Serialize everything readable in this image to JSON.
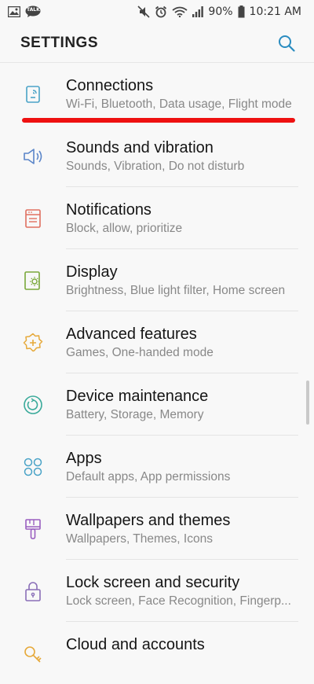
{
  "status_bar": {
    "battery_percent": "90%",
    "time": "10:21 AM",
    "talk_badge": "TALK"
  },
  "header": {
    "title": "SETTINGS"
  },
  "settings": [
    {
      "title": "Connections",
      "subtitle": "Wi-Fi, Bluetooth, Data usage, Flight mode",
      "icon": "connections-icon",
      "color": "#4aa3c7"
    },
    {
      "title": "Sounds and vibration",
      "subtitle": "Sounds, Vibration, Do not disturb",
      "icon": "speaker-icon",
      "color": "#5b86c9"
    },
    {
      "title": "Notifications",
      "subtitle": "Block, allow, prioritize",
      "icon": "notifications-icon",
      "color": "#e07060"
    },
    {
      "title": "Display",
      "subtitle": "Brightness, Blue light filter, Home screen",
      "icon": "display-icon",
      "color": "#7aa83a"
    },
    {
      "title": "Advanced features",
      "subtitle": "Games, One-handed mode",
      "icon": "advanced-gear-icon",
      "color": "#e6a93a"
    },
    {
      "title": "Device maintenance",
      "subtitle": "Battery, Storage, Memory",
      "icon": "maintenance-icon",
      "color": "#3aaa9a"
    },
    {
      "title": "Apps",
      "subtitle": "Default apps, App permissions",
      "icon": "apps-grid-icon",
      "color": "#4aa3c7"
    },
    {
      "title": "Wallpapers and themes",
      "subtitle": "Wallpapers, Themes, Icons",
      "icon": "paintbrush-icon",
      "color": "#9a5fc0"
    },
    {
      "title": "Lock screen and security",
      "subtitle": "Lock screen, Face Recognition, Fingerp...",
      "icon": "lock-icon",
      "color": "#8a6fb8"
    },
    {
      "title": "Cloud and accounts",
      "subtitle": "",
      "icon": "cloud-key-icon",
      "color": "#e6a93a"
    }
  ],
  "colors": {
    "accent": "#2a8cc0",
    "highlight": "#ee1111"
  }
}
